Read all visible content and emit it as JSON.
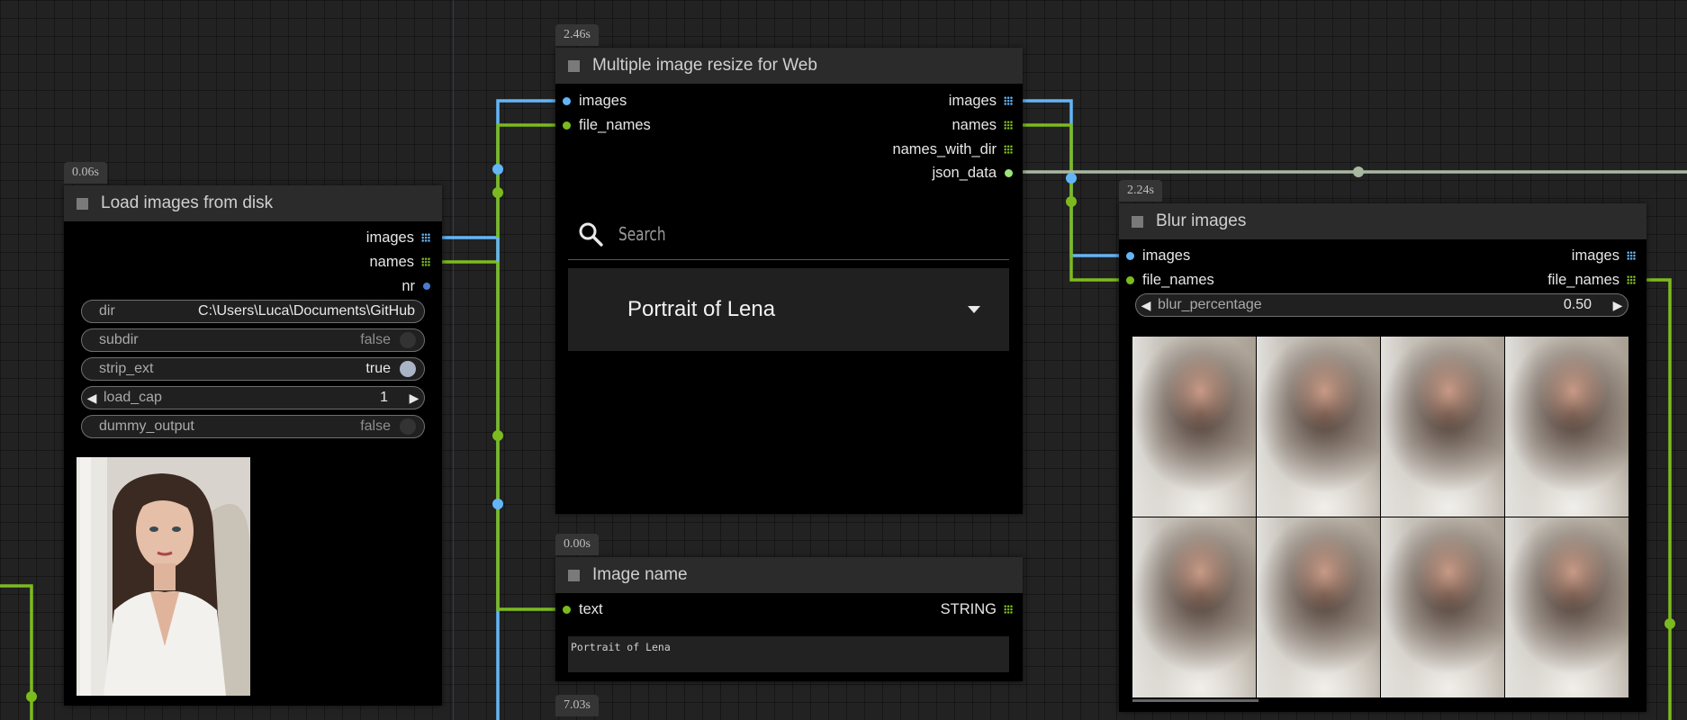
{
  "colors": {
    "image_link": "#64b5f6",
    "name_link": "#7cbb1f",
    "json_link": "#a9b8a1",
    "int_slot": "#4a7bd0",
    "canvas_bg": "#222222"
  },
  "icons": {
    "search": "search-icon",
    "dropdown": "chevron-down-icon",
    "node": "node-collapse-icon"
  },
  "badges": {
    "load": "0.06s",
    "resize": "2.46s",
    "blur": "2.24s",
    "name": "0.00s",
    "bottom": "7.03s"
  },
  "load_node": {
    "title": "Load images from disk",
    "outputs": [
      "images",
      "names",
      "nr"
    ],
    "widgets": {
      "dir_label": "dir",
      "dir_value": "C:\\Users\\Luca\\Documents\\GitHub",
      "subdir_label": "subdir",
      "subdir_value": "false",
      "strip_label": "strip_ext",
      "strip_value": "true",
      "cap_label": "load_cap",
      "cap_value": "1",
      "dummy_label": "dummy_output",
      "dummy_value": "false"
    }
  },
  "resize_node": {
    "title": "Multiple image resize for Web",
    "inputs": [
      "images",
      "file_names"
    ],
    "outputs": [
      "images",
      "names",
      "names_with_dir",
      "json_data"
    ],
    "search_placeholder": "Search",
    "selected": "Portrait of Lena"
  },
  "blur_node": {
    "title": "Blur images",
    "inputs": [
      "images",
      "file_names"
    ],
    "outputs": [
      "images",
      "file_names"
    ],
    "widget_label": "blur_percentage",
    "widget_value": "0.50"
  },
  "name_node": {
    "title": "Image name",
    "input": "text",
    "output": "STRING",
    "text_value": "Portrait of Lena"
  }
}
